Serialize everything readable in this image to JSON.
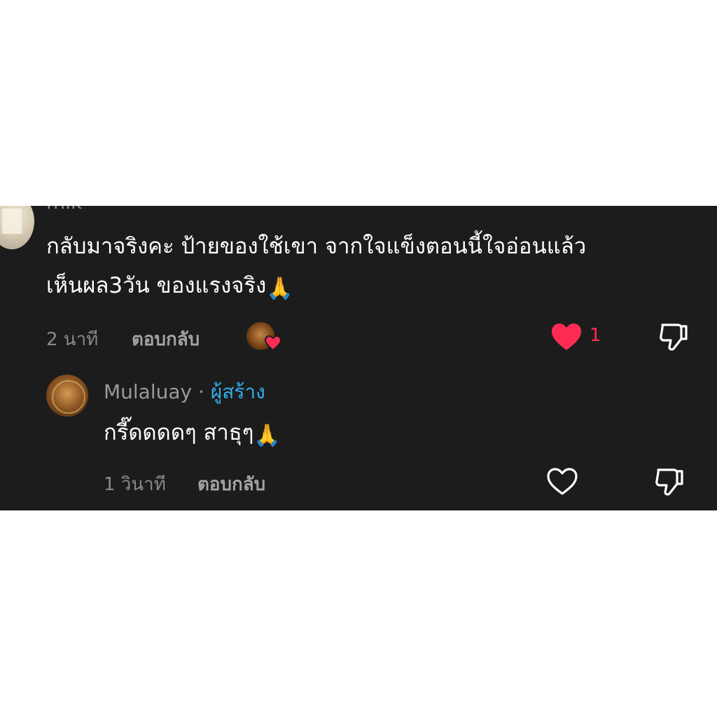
{
  "comments": [
    {
      "username": "mik",
      "text_line1": "กลับมาจริงคะ ป้ายของใช้เขา จากใจแข็งตอนนี้ใจอ่อนแล้ว",
      "text_line2": "เห็นผล3วัน ของแรงจริง",
      "emoji": "🙏",
      "time": "2 นาที",
      "reply_label": "ตอบกลับ",
      "like_count": "1",
      "liked": true
    },
    {
      "username": "Mulaluay",
      "separator": "·",
      "creator_badge": "ผู้สร้าง",
      "text": "กรี๊ดดดดๆ สาธุๆ",
      "emoji": "🙏",
      "time": "1 วินาที",
      "reply_label": "ตอบกลับ",
      "liked": false
    }
  ],
  "icons": {
    "like_filled": "heart-filled-icon",
    "like_outline": "heart-outline-icon",
    "dislike": "thumbs-down-icon",
    "creator_liked": "heart-badge-icon"
  },
  "colors": {
    "background": "#1c1c1c",
    "like_red": "#fe2c55",
    "creator_badge_blue": "#33aee8",
    "secondary_text": "#8a8a8a"
  }
}
